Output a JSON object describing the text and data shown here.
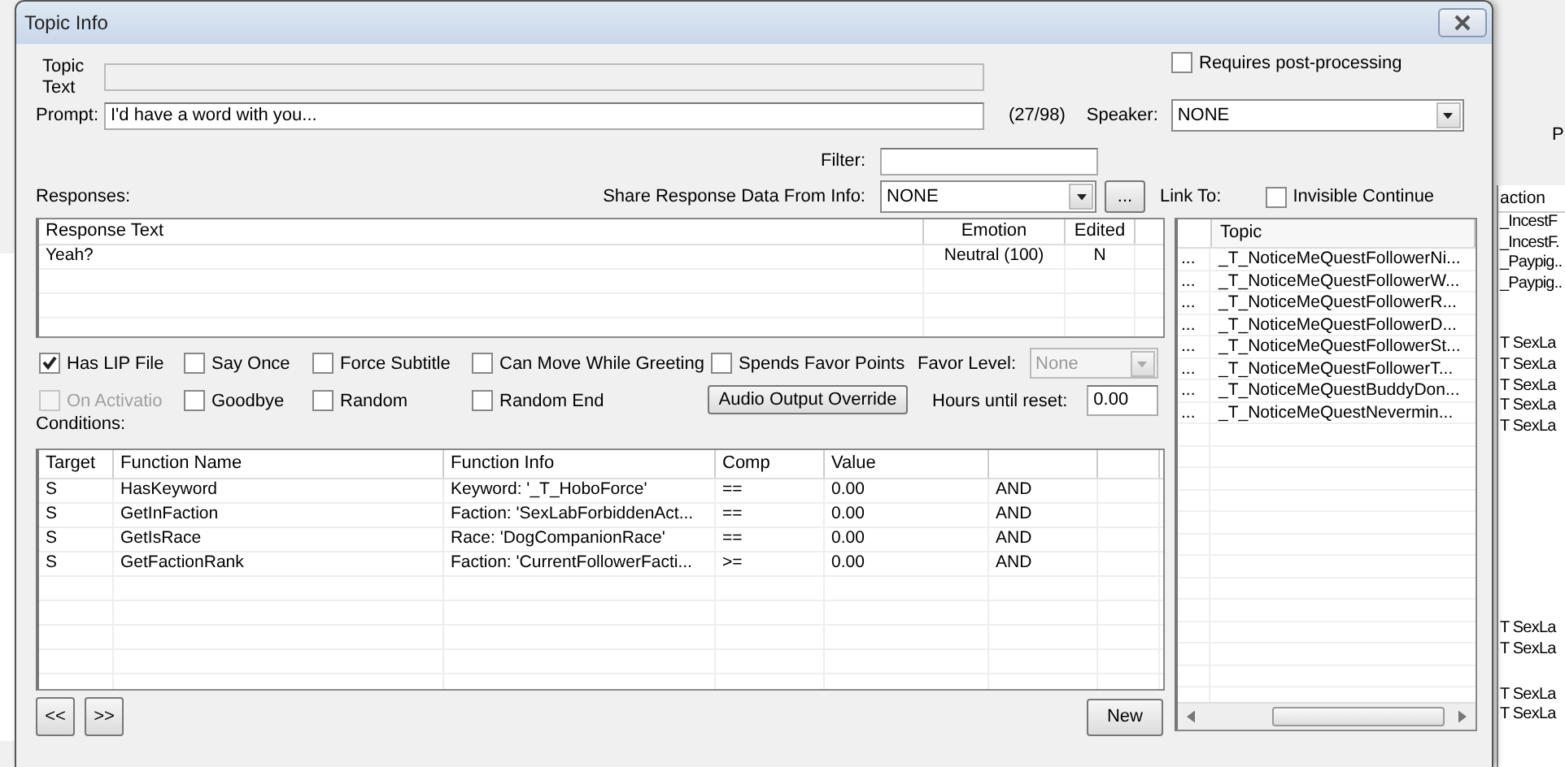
{
  "background_window": {
    "right_header": "P",
    "right_column": "action",
    "right_groups": [
      [
        "_IncestF",
        "_IncestF.",
        "_Paypig..",
        "_Paypig.."
      ],
      [
        "T SexLa",
        "T SexLa",
        "T SexLa",
        "T SexLa",
        "T SexLa"
      ],
      [
        "T SexLa",
        "T SexLa"
      ],
      [
        "T SexLa",
        "T SexLa"
      ]
    ]
  },
  "dialog": {
    "title": "Topic Info",
    "topic_text": {
      "label": "Topic Text",
      "disabled": true
    },
    "requires_post_processing": {
      "label": "Requires post-processing",
      "checked": false
    },
    "prompt": {
      "label": "Prompt:",
      "value": "I'd have a word with you..."
    },
    "char_count": "(27/98)",
    "speaker": {
      "label": "Speaker:",
      "value": "NONE"
    },
    "filter": {
      "label": "Filter:"
    },
    "responses_label": "Responses:",
    "share": {
      "label": "Share Response Data From Info:",
      "value": "NONE",
      "button": "..."
    },
    "link_to_label": "Link To:",
    "invisible_continue": {
      "label": "Invisible Continue",
      "checked": false
    },
    "responses": {
      "columns": [
        "Response Text",
        "Emotion",
        "Edited"
      ],
      "rows": [
        [
          "Yeah?",
          "Neutral (100)",
          "N"
        ]
      ]
    },
    "options": [
      {
        "kind": "checkbox",
        "label": "Has LIP File",
        "checked": true,
        "disabled": false
      },
      {
        "kind": "checkbox",
        "label": "Say Once",
        "checked": false,
        "disabled": false
      },
      {
        "kind": "checkbox",
        "label": "Force Subtitle",
        "checked": false,
        "disabled": false
      },
      {
        "kind": "checkbox",
        "label": "Can Move While Greeting",
        "checked": false,
        "disabled": false
      },
      {
        "kind": "checkbox",
        "label": "Spends Favor Points",
        "checked": false,
        "disabled": false
      },
      {
        "kind": "combo",
        "label": "Favor Level:",
        "value": "None",
        "disabled": true
      },
      {
        "kind": "checkbox",
        "label": "On Activatio",
        "checked": false,
        "disabled": true
      },
      {
        "kind": "checkbox",
        "label": "Goodbye",
        "checked": false,
        "disabled": false
      },
      {
        "kind": "checkbox",
        "label": "Random",
        "checked": false,
        "disabled": false
      },
      {
        "kind": "checkbox",
        "label": "Random End",
        "checked": false,
        "disabled": false
      },
      {
        "kind": "button",
        "label": "Audio Output Override"
      },
      {
        "kind": "field",
        "label": "Hours until reset:",
        "value": "0.00"
      }
    ],
    "conditions_label": "Conditions:",
    "conditions": {
      "columns": [
        "Target",
        "Function Name",
        "Function Info",
        "Comp",
        "Value"
      ],
      "rows": [
        [
          "S",
          "HasKeyword",
          "Keyword: '_T_HoboForce'",
          "==",
          "0.00",
          "AND"
        ],
        [
          "S",
          "GetInFaction",
          "Faction: 'SexLabForbiddenAct...",
          "==",
          "0.00",
          "AND"
        ],
        [
          "S",
          "GetIsRace",
          "Race: 'DogCompanionRace'",
          "==",
          "0.00",
          "AND"
        ],
        [
          "S",
          "GetFactionRank",
          "Faction: 'CurrentFollowerFacti...",
          ">=",
          "0.00",
          "AND"
        ]
      ]
    },
    "nav_buttons": [
      "<<",
      ">>"
    ],
    "new_button": "New",
    "link_list": {
      "column": "Topic",
      "rows": [
        {
          "marker": "...",
          "topic": "_T_NoticeMeQuestFollowerNi..."
        },
        {
          "marker": "...",
          "topic": "_T_NoticeMeQuestFollowerW..."
        },
        {
          "marker": "...",
          "topic": "_T_NoticeMeQuestFollowerR..."
        },
        {
          "marker": "...",
          "topic": "_T_NoticeMeQuestFollowerD..."
        },
        {
          "marker": "...",
          "topic": "_T_NoticeMeQuestFollowerSt..."
        },
        {
          "marker": "...",
          "topic": "_T_NoticeMeQuestFollowerT..."
        },
        {
          "marker": "...",
          "topic": "_T_NoticeMeQuestBuddyDon..."
        },
        {
          "marker": "...",
          "topic": "_T_NoticeMeQuestNevermin..."
        }
      ]
    }
  }
}
